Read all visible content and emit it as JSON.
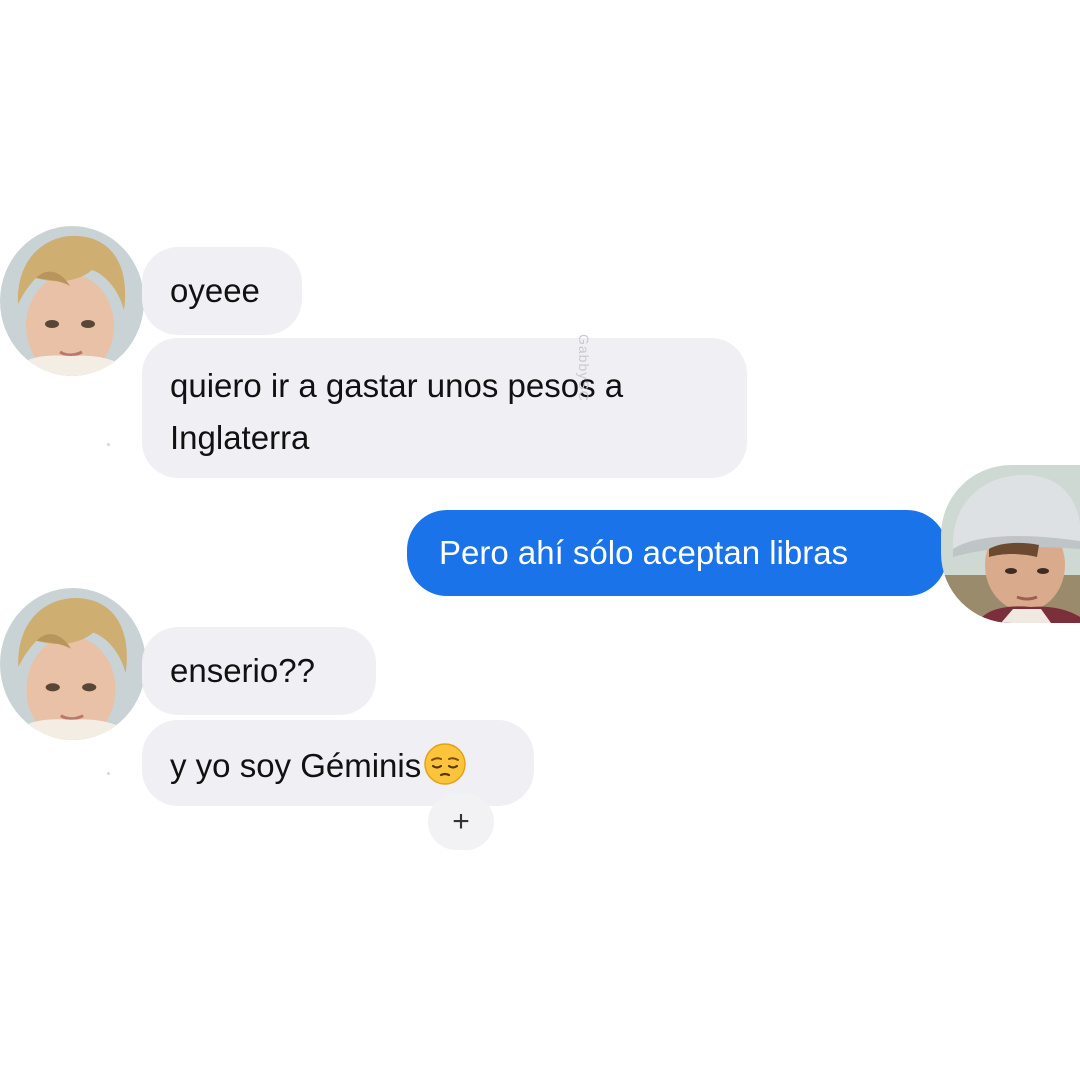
{
  "conversation": {
    "messages": [
      {
        "sender": "friend",
        "text": "oyeee"
      },
      {
        "sender": "friend",
        "text_line1": "quiero ir a gastar unos pesos a",
        "text_line2": "Inglaterra"
      },
      {
        "sender": "me",
        "text": "Pero ahí sólo aceptan libras"
      },
      {
        "sender": "friend",
        "text": "enserio??"
      },
      {
        "sender": "friend",
        "text": "y yo soy Géminis",
        "emoji": "pensive-face-icon"
      }
    ],
    "add_reaction_label": "+",
    "watermark": "GabbySC"
  },
  "colors": {
    "outgoing_bubble": "#1a73e8",
    "incoming_bubble": "#f0f0f4",
    "background": "#ffffff"
  }
}
